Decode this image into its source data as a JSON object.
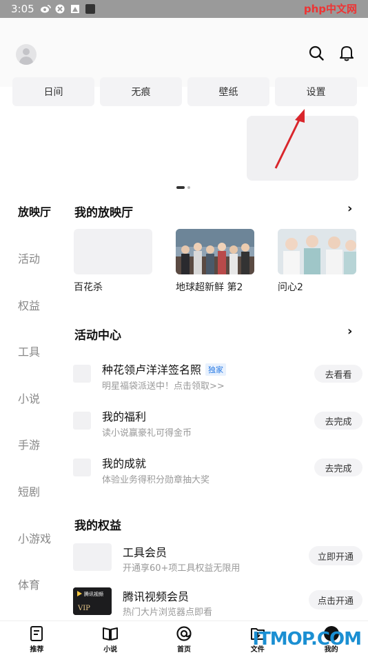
{
  "status_bar": {
    "time": "3:05"
  },
  "watermark_top": "php中文网",
  "quick_tabs": [
    "日间",
    "无痕",
    "壁纸",
    "设置"
  ],
  "left_nav": [
    "放映厅",
    "活动",
    "权益",
    "工具",
    "小说",
    "手游",
    "短剧",
    "小游戏",
    "体育"
  ],
  "theater": {
    "title": "我的放映厅",
    "arrow": "›",
    "cards": [
      "百花杀",
      "地球超新鲜 第2",
      "问心2"
    ]
  },
  "activity": {
    "title": "活动中心",
    "arrow": "›",
    "items": [
      {
        "title": "种花领卢洋洋签名照",
        "badge": "独家",
        "subtitle": "明星福袋派送中！点击领取>>",
        "button": "去看看"
      },
      {
        "title": "我的福利",
        "subtitle": "读小说赢豪礼可得金币",
        "button": "去完成"
      },
      {
        "title": "我的成就",
        "subtitle": "体验业务得积分勋章抽大奖",
        "button": "去完成"
      }
    ]
  },
  "benefits": {
    "title": "我的权益",
    "items": [
      {
        "title": "工具会员",
        "subtitle": "开通享60+项工具权益无限用",
        "button": "立即开通"
      },
      {
        "title": "腾讯视频会员",
        "subtitle": "热门大片浏览器点即看",
        "button": "点击开通",
        "logo_text": "腾讯视频",
        "vip_text": "VIP"
      }
    ]
  },
  "bottom_tabs": [
    "推荐",
    "小说",
    "首页",
    "文件",
    "我的"
  ],
  "watermark_bottom": "ITMOP.COM",
  "colors": {
    "accent_blue": "#2a7be4",
    "arrow_red": "#d9262c"
  }
}
